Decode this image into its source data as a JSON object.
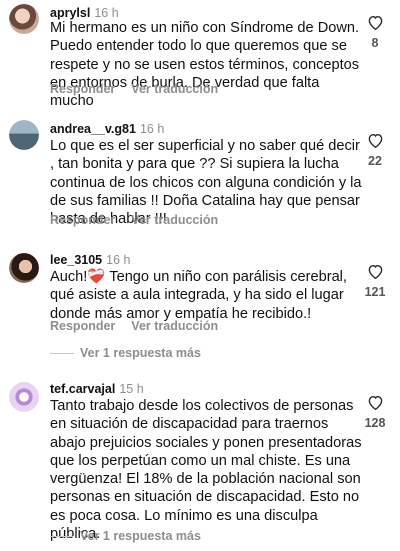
{
  "labels": {
    "reply": "Responder",
    "translate": "Ver traducción"
  },
  "comments": [
    {
      "username": "aprylsl",
      "time": "16 h",
      "text": "Mi hermano es un niño con Síndrome de Down. Puedo entender todo lo que queremos que se respete y no se usen estos términos, conceptos en entornos de burla. De verdad que falta mucho",
      "likes": "8"
    },
    {
      "username": "andrea__v.g81",
      "time": "16 h",
      "text": "Lo que es  el ser superficial y no saber qué decir , tan bonita y para que ?? Si supiera la lucha continua de los chicos con  alguna condición y la de sus familias !! Doña Catalina hay que pensar hasta de hablar !!!",
      "likes": "22"
    },
    {
      "username": "lee_3105",
      "time": "16 h",
      "text": "Auch!❤️‍🩹  Tengo un niño con parálisis cerebral, qué asiste a aula integrada,  y ha sido el lugar donde más amor y empatía he recibido.!",
      "likes": "121",
      "replies": "Ver 1 respuesta más"
    },
    {
      "username": "tef.carvajal",
      "time": "15 h",
      "text": "Tanto trabajo desde los colectivos de personas en situación de discapacidad para traernos abajo prejuicios sociales y ponen presentadoras que los perpetúan como un mal chiste. Es una vergüenza! El 18% de la población nacional son personas en situación de discapacidad. Esto no es poca cosa. Lo mínimo es una disculpa pública.",
      "likes": "128",
      "replies": "Ver 1 respuesta más"
    }
  ],
  "colors": {
    "muted": "#8e8e8e",
    "text": "#111111",
    "heart": "#262626"
  },
  "icons": {
    "like": "heart-outline-icon"
  }
}
